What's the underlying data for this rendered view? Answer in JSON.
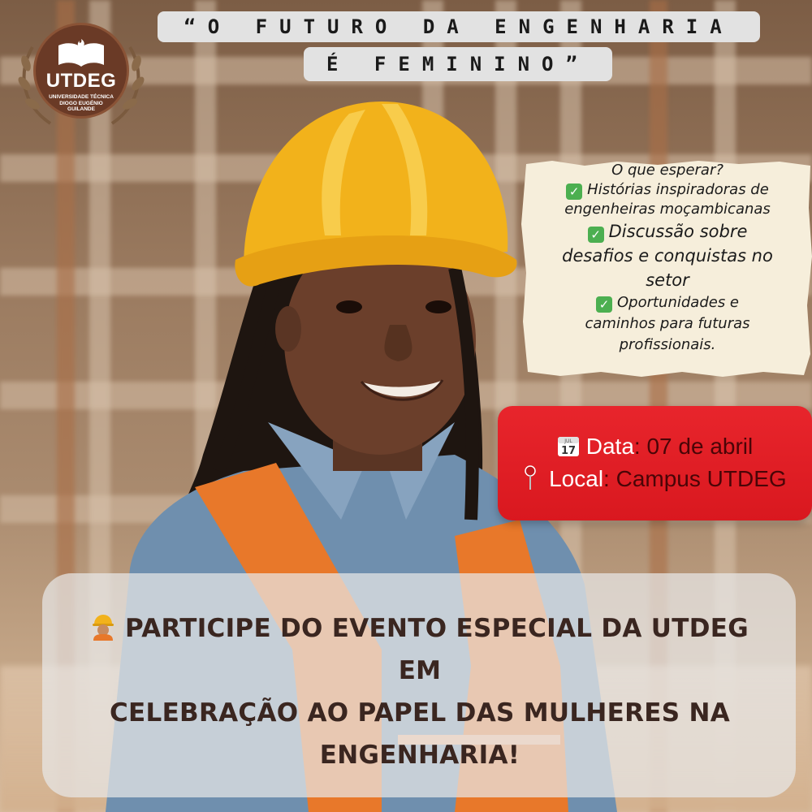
{
  "logo": {
    "acronym": "UTDEG",
    "name_line1": "UNIVERSIDADE TÉCNICA",
    "name_line2": "DIOGO EUGÉNIO",
    "name_line3": "GUILANDE"
  },
  "quote": {
    "line1": "“O FUTURO DA ENGENHARIA",
    "line2": "É FEMININO”"
  },
  "expect_note": {
    "heading": "O que esperar?",
    "item1_line1": "Histórias inspiradoras de",
    "item1_line2": "engenheiras moçambicanas",
    "item2_line1": "Discussão sobre",
    "item2_line2": "desafios e conquistas no",
    "item2_line3": "setor",
    "item3_line1": "Oportunidades e",
    "item3_line2": "caminhos para futuras",
    "item3_line3": "profissionais."
  },
  "event_info": {
    "calendar_icon_text": "17",
    "calendar_icon_month": "JUL",
    "date_label": "Data",
    "date_value": ": 07 de abril",
    "location_label": " Local",
    "location_value": ": Campus UTDEG"
  },
  "banner": {
    "line1": "PARTICIPE DO EVENTO ESPECIAL DA UTDEG EM",
    "line2": "CELEBRAÇÃO AO PAPEL DAS MULHERES NA",
    "line3": "ENGENHARIA!"
  },
  "colors": {
    "red_box": "#e8252c",
    "paper": "#f6eedb",
    "logo_brown": "#6a3a26",
    "helmet": "#f2b21b",
    "vest": "#e8782a",
    "shirt": "#6f8fae",
    "check_green": "#4caf50"
  },
  "icons": [
    "book-icon",
    "laurel-icon",
    "check-icon",
    "calendar-icon",
    "pin-icon",
    "worker-emoji-icon"
  ]
}
